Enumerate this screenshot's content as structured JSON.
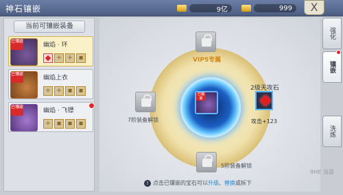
{
  "header": {
    "title": "神石镶嵌",
    "currency1": "9亿",
    "currency2": "999",
    "close": "X"
  },
  "left": {
    "heading": "当前可镶嵌装备",
    "items": [
      {
        "name": "幽焰 · 环",
        "tag": "已镶嵌"
      },
      {
        "name": "幽焰上衣",
        "tag": "已镶嵌"
      },
      {
        "name": "幽焰 · 飞镖",
        "tag": "已镶嵌"
      }
    ]
  },
  "center": {
    "vip_label": "VIP5专属",
    "left_lock": "7阶装备解锁",
    "bottom_lock": "5阶装备解锁",
    "gem_name": "2级天攻石",
    "gem_stat": "攻击+123",
    "center_tag": "已镶嵌"
  },
  "tabs": [
    {
      "label": "强化"
    },
    {
      "label": "镶嵌"
    },
    {
      "label": "洗炼"
    }
  ],
  "hint": {
    "pre": "点击已镶嵌的宝石可以",
    "upgrade": "升级",
    "sep": "、",
    "replace": "替换",
    "post": "或拆下"
  },
  "watermark": "9HE 当游"
}
